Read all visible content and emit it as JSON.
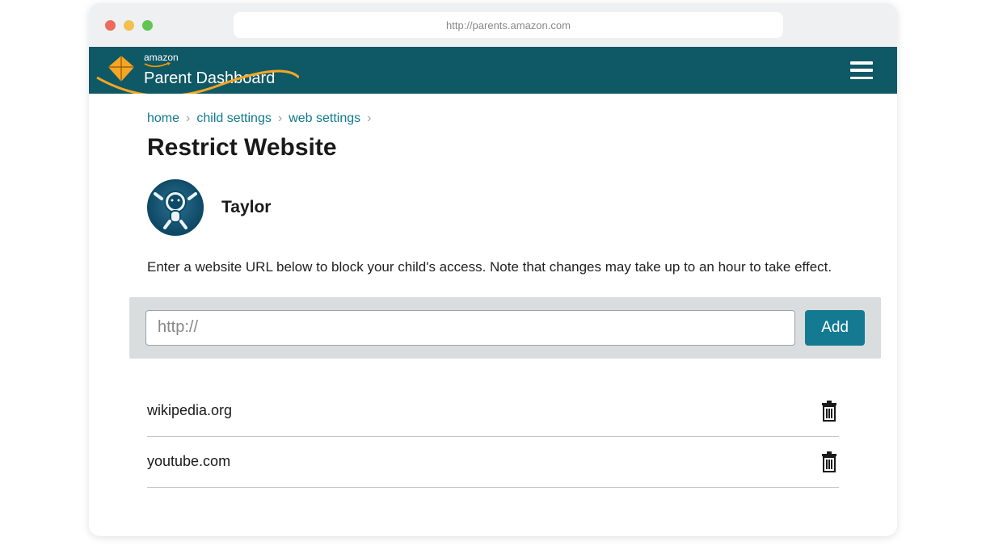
{
  "browser": {
    "url": "http://parents.amazon.com"
  },
  "brand": {
    "small": "amazon",
    "big": "Parent Dashboard"
  },
  "breadcrumb": {
    "items": [
      {
        "label": "home"
      },
      {
        "label": "child settings"
      },
      {
        "label": "web settings"
      }
    ]
  },
  "page": {
    "title": "Restrict Website",
    "child_name": "Taylor",
    "description": "Enter a website URL below to block your child's access. Note that changes may take up to an hour to take effect.",
    "url_placeholder": "http://",
    "url_value": "",
    "add_label": "Add"
  },
  "blocked": [
    {
      "url": "wikipedia.org"
    },
    {
      "url": "youtube.com"
    }
  ]
}
